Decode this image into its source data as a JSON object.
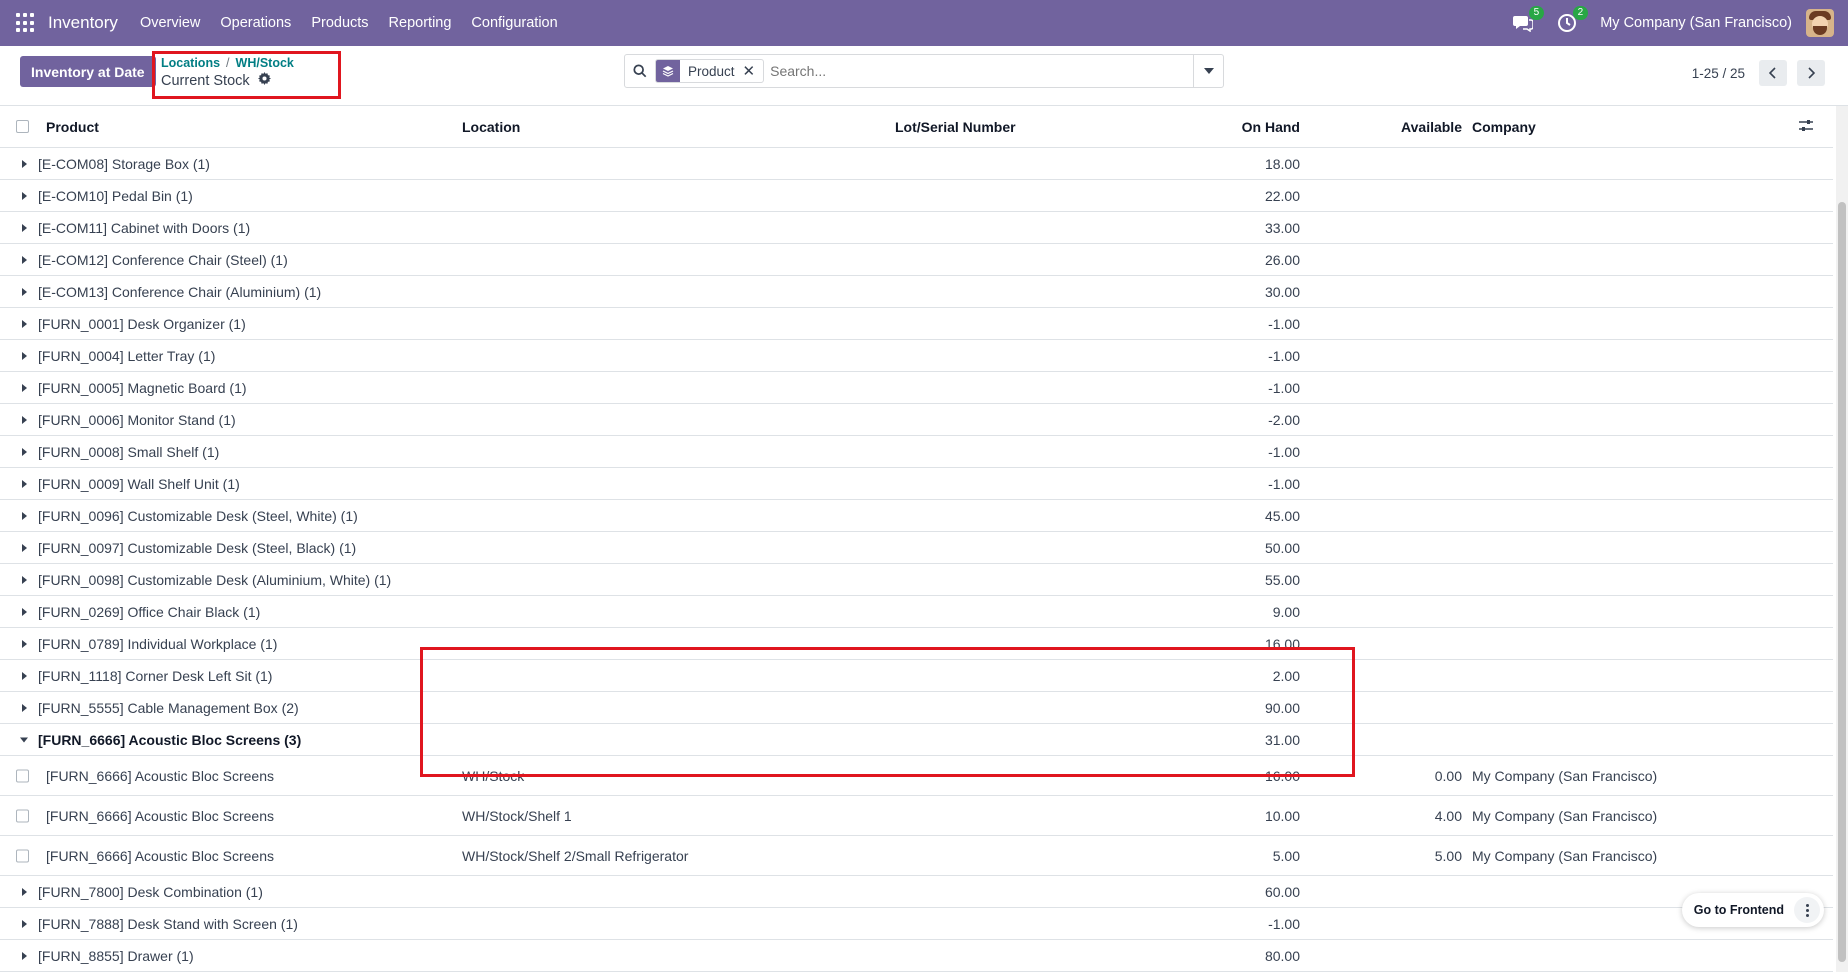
{
  "navbar": {
    "app_name": "Inventory",
    "menu": [
      "Overview",
      "Operations",
      "Products",
      "Reporting",
      "Configuration"
    ],
    "messages_count": "5",
    "activities_count": "2",
    "company": "My Company (San Francisco)"
  },
  "control": {
    "inventory_at_date": "Inventory at Date",
    "breadcrumb": [
      "Locations",
      "WH/Stock"
    ],
    "breadcrumb_sep": "/",
    "current": "Current Stock",
    "facet_label": "Product",
    "search_placeholder": "Search...",
    "pager": "1-25 / 25"
  },
  "table": {
    "headers": {
      "product": "Product",
      "location": "Location",
      "lot": "Lot/Serial Number",
      "on_hand": "On Hand",
      "available": "Available",
      "company": "Company"
    },
    "groups_before": [
      {
        "label": "[E-COM08] Storage Box (1)",
        "on_hand": "18.00"
      },
      {
        "label": "[E-COM10] Pedal Bin (1)",
        "on_hand": "22.00"
      },
      {
        "label": "[E-COM11] Cabinet with Doors (1)",
        "on_hand": "33.00"
      },
      {
        "label": "[E-COM12] Conference Chair (Steel) (1)",
        "on_hand": "26.00"
      },
      {
        "label": "[E-COM13] Conference Chair (Aluminium) (1)",
        "on_hand": "30.00"
      },
      {
        "label": "[FURN_0001] Desk Organizer (1)",
        "on_hand": "-1.00"
      },
      {
        "label": "[FURN_0004] Letter Tray (1)",
        "on_hand": "-1.00"
      },
      {
        "label": "[FURN_0005] Magnetic Board (1)",
        "on_hand": "-1.00"
      },
      {
        "label": "[FURN_0006] Monitor Stand (1)",
        "on_hand": "-2.00"
      },
      {
        "label": "[FURN_0008] Small Shelf (1)",
        "on_hand": "-1.00"
      },
      {
        "label": "[FURN_0009] Wall Shelf Unit (1)",
        "on_hand": "-1.00"
      },
      {
        "label": "[FURN_0096] Customizable Desk (Steel, White) (1)",
        "on_hand": "45.00"
      },
      {
        "label": "[FURN_0097] Customizable Desk (Steel, Black) (1)",
        "on_hand": "50.00"
      },
      {
        "label": "[FURN_0098] Customizable Desk (Aluminium, White) (1)",
        "on_hand": "55.00"
      },
      {
        "label": "[FURN_0269] Office Chair Black (1)",
        "on_hand": "9.00"
      },
      {
        "label": "[FURN_0789] Individual Workplace (1)",
        "on_hand": "16.00"
      },
      {
        "label": "[FURN_1118] Corner Desk Left Sit (1)",
        "on_hand": "2.00"
      },
      {
        "label": "[FURN_5555] Cable Management Box (2)",
        "on_hand": "90.00"
      }
    ],
    "open_group": {
      "label": "[FURN_6666] Acoustic Bloc Screens (3)",
      "on_hand": "31.00"
    },
    "sub_rows": [
      {
        "product": "[FURN_6666] Acoustic Bloc Screens",
        "location": "WH/Stock",
        "on_hand": "16.00",
        "available": "0.00",
        "company": "My Company (San Francisco)"
      },
      {
        "product": "[FURN_6666] Acoustic Bloc Screens",
        "location": "WH/Stock/Shelf 1",
        "on_hand": "10.00",
        "available": "4.00",
        "company": "My Company (San Francisco)"
      },
      {
        "product": "[FURN_6666] Acoustic Bloc Screens",
        "location": "WH/Stock/Shelf 2/Small Refrigerator",
        "on_hand": "5.00",
        "available": "5.00",
        "company": "My Company (San Francisco)"
      }
    ],
    "groups_after": [
      {
        "label": "[FURN_7800] Desk Combination (1)",
        "on_hand": "60.00"
      },
      {
        "label": "[FURN_7888] Desk Stand with Screen (1)",
        "on_hand": "-1.00"
      },
      {
        "label": "[FURN_8855] Drawer (1)",
        "on_hand": "80.00"
      }
    ]
  },
  "widget": {
    "go_frontend": "Go to Frontend"
  },
  "colors": {
    "brand": "#71639e",
    "highlight": "#e0161f",
    "badge": "#28a745",
    "link": "#017e84"
  }
}
